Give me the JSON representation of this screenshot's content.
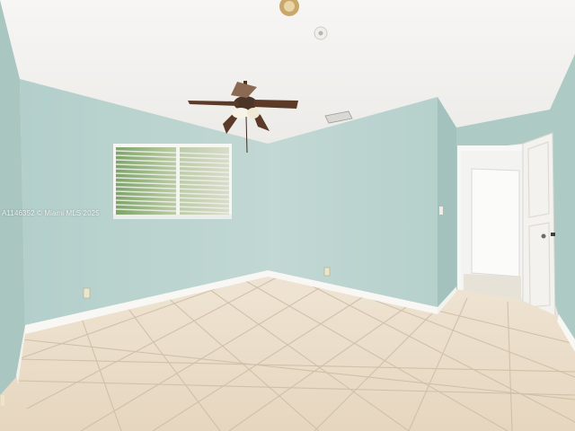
{
  "photo": {
    "subject": "empty-bedroom",
    "watermark": "A1146352 © Miami MLS 2025"
  },
  "colors": {
    "ceiling": "#f5f4f2",
    "wall_left": "#b8d2cd",
    "wall_back": "#b9d4d0",
    "wall_right_far": "#a9c7c2",
    "floor_tile": "#eadcc7",
    "grout": "#cdbca5",
    "baseboard": "#f8f7f4",
    "door": "#f1efeb",
    "fan_blade": "#5b3a28"
  }
}
